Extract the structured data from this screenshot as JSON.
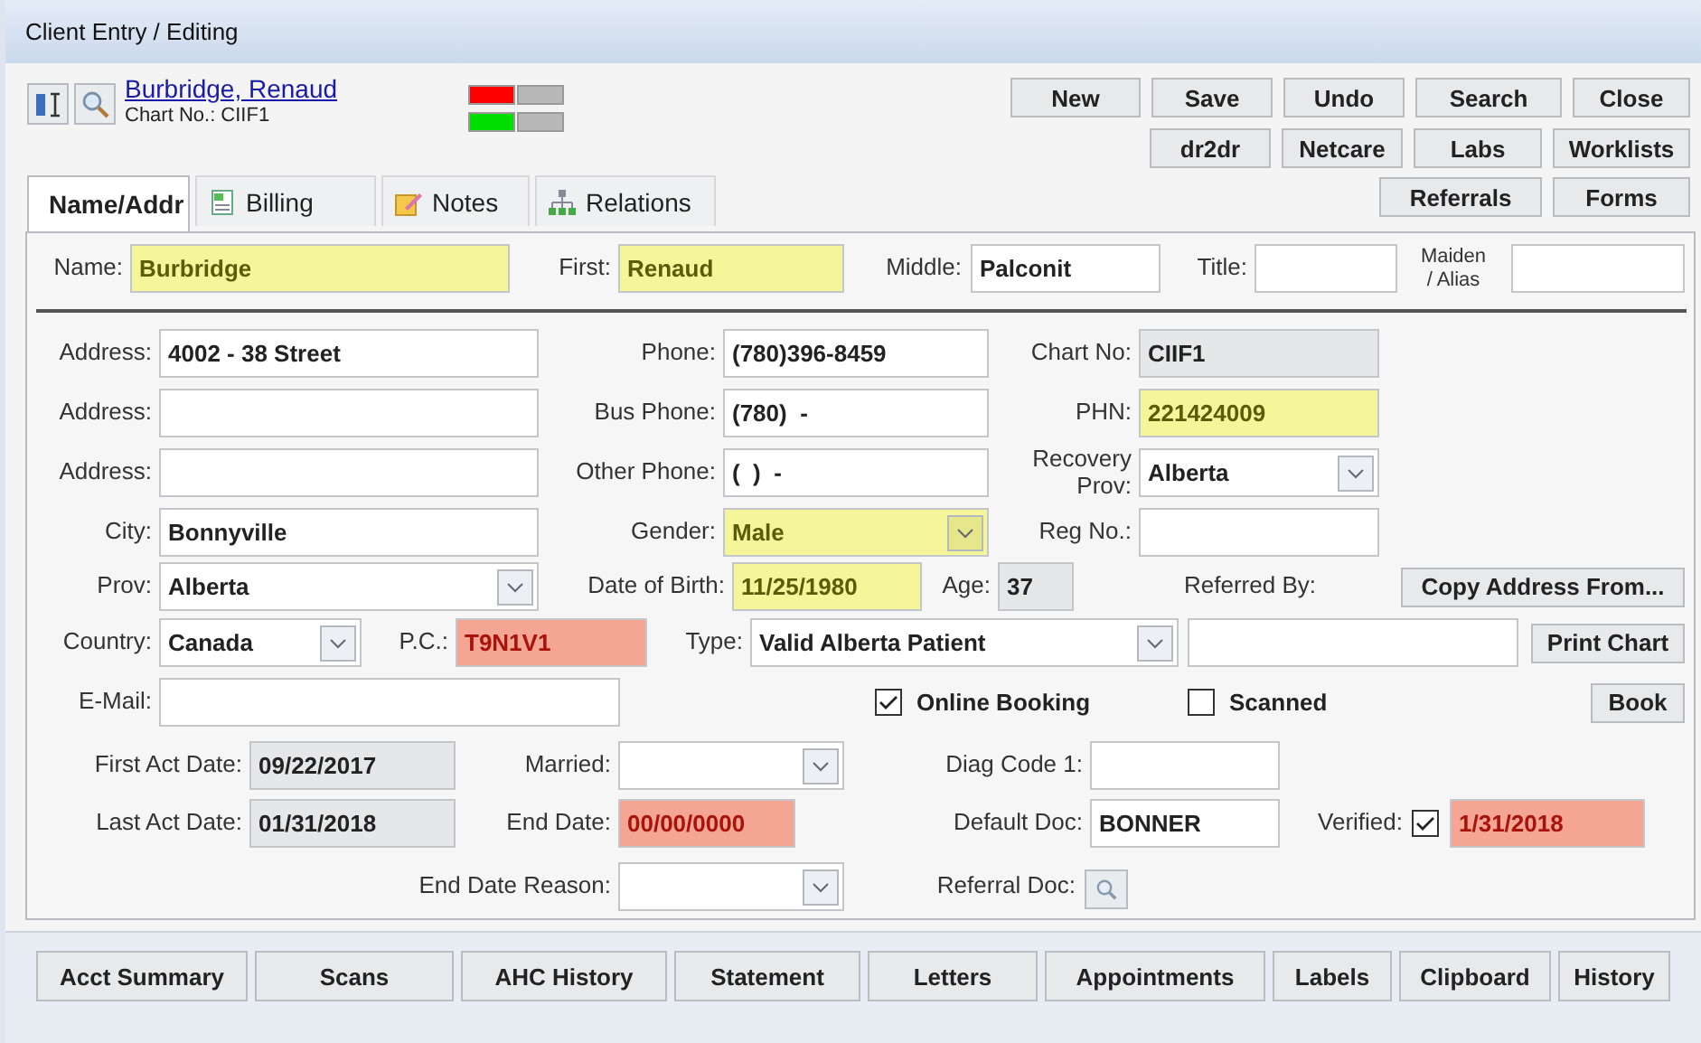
{
  "window": {
    "title": "Client Entry / Editing"
  },
  "header": {
    "patient_link": "Burbridge, Renaud",
    "chart_no": "Chart No.: CIIF1",
    "indicators": [
      {
        "color": "#ff0000"
      },
      {
        "color": "#b8b8b8"
      },
      {
        "color": "#00dd00"
      },
      {
        "color": "#b8b8b8"
      }
    ]
  },
  "toolbar": [
    [
      {
        "label": "New"
      },
      {
        "label": "Save"
      },
      {
        "label": "Undo"
      },
      {
        "label": "Search"
      },
      {
        "label": "Close"
      }
    ],
    [
      {
        "label": "dr2dr"
      },
      {
        "label": "Netcare"
      },
      {
        "label": "Labs"
      },
      {
        "label": "Worklists"
      }
    ],
    [
      {
        "label": "Referrals"
      },
      {
        "label": "Forms"
      }
    ]
  ],
  "tabs": [
    {
      "label": "Name/Addr",
      "selected": true
    },
    {
      "label": "Billing",
      "selected": false
    },
    {
      "label": "Notes",
      "selected": false
    },
    {
      "label": "Relations",
      "selected": false
    }
  ],
  "form_rows": [
    [
      {
        "kind": "label",
        "text": "Name:"
      },
      {
        "kind": "requiredfield",
        "value": "Burbridge"
      },
      {
        "kind": "label",
        "text": "First:"
      },
      {
        "kind": "requiredfield",
        "value": "Renaud"
      },
      {
        "kind": "label",
        "text": "Middle:"
      },
      {
        "kind": "field",
        "value": "Palconit"
      },
      {
        "kind": "label",
        "text": "Title:"
      },
      {
        "kind": "field"
      },
      {
        "kind": "label",
        "text": "Maiden\n/ Alias"
      },
      {
        "kind": "field"
      }
    ],
    [
      {
        "kind": "label",
        "text": "Address:"
      },
      {
        "kind": "field",
        "value": "4002 - 38 Street"
      },
      {
        "kind": "label",
        "text": "Phone:"
      },
      {
        "kind": "field",
        "value": "(780)396-8459"
      },
      {
        "kind": "label",
        "text": "Chart No:"
      },
      {
        "kind": "readonlyfield",
        "value": "CIIF1"
      }
    ],
    [
      {
        "kind": "label",
        "text": "Address:"
      },
      {
        "kind": "field"
      },
      {
        "kind": "label",
        "text": "Bus Phone:"
      },
      {
        "kind": "field",
        "value": "(780)  -"
      },
      {
        "kind": "label",
        "text": "PHN:"
      },
      {
        "kind": "requiredfield",
        "value": "221424009"
      }
    ],
    [
      {
        "kind": "label",
        "text": "Address:"
      },
      {
        "kind": "field"
      },
      {
        "kind": "label",
        "text": "Other Phone:"
      },
      {
        "kind": "field",
        "value": "(  )  -"
      },
      {
        "kind": "label",
        "text": "Recovery\nProv:"
      },
      {
        "kind": "select",
        "value": "Alberta"
      }
    ],
    [
      {
        "kind": "label",
        "text": "City:"
      },
      {
        "kind": "field",
        "value": "Bonnyville"
      },
      {
        "kind": "label",
        "text": "Gender:"
      },
      {
        "kind": "requiredselect",
        "value": "Male"
      },
      {
        "kind": "label",
        "text": "Reg No.:"
      },
      {
        "kind": "field"
      }
    ],
    [
      {
        "kind": "label",
        "text": "Prov:"
      },
      {
        "kind": "select",
        "value": "Alberta"
      },
      {
        "kind": "label",
        "text": "Date of Birth:"
      },
      {
        "kind": "requiredfield",
        "value": "11/25/1980"
      },
      {
        "kind": "label",
        "text": "Age:"
      },
      {
        "kind": "readonlyfield",
        "value": "37"
      },
      {
        "kind": "label",
        "text": "Referred By:"
      },
      {
        "kind": "button",
        "label": "Copy Address From..."
      }
    ],
    [
      {
        "kind": "label",
        "text": "Country:"
      },
      {
        "kind": "select",
        "value": "Canada"
      },
      {
        "kind": "label",
        "text": "P.C.:"
      },
      {
        "kind": "invalidfield",
        "value": "T9N1V1"
      },
      {
        "kind": "label",
        "text": "Type:"
      },
      {
        "kind": "select",
        "value": "Valid Alberta Patient"
      },
      {
        "kind": "field"
      },
      {
        "kind": "button",
        "label": "Print Chart"
      }
    ],
    [
      {
        "kind": "label",
        "text": "E-Mail:"
      },
      {
        "kind": "field"
      },
      {
        "kind": "check",
        "label": "Online Booking",
        "checked": true
      },
      {
        "kind": "check",
        "label": "Scanned",
        "checked": false
      },
      {
        "kind": "button",
        "label": "Book"
      }
    ],
    [
      {
        "kind": "label",
        "text": "First Act Date:"
      },
      {
        "kind": "readonlyfield",
        "value": "09/22/2017"
      },
      {
        "kind": "label",
        "text": "Married:"
      },
      {
        "kind": "select"
      },
      {
        "kind": "label",
        "text": "Diag Code 1:"
      },
      {
        "kind": "field"
      }
    ],
    [
      {
        "kind": "label",
        "text": "Last Act Date:"
      },
      {
        "kind": "readonlyfield",
        "value": "01/31/2018"
      },
      {
        "kind": "label",
        "text": "End Date:"
      },
      {
        "kind": "invalidfield",
        "value": "00/00/0000"
      },
      {
        "kind": "label",
        "text": "Default Doc:"
      },
      {
        "kind": "field",
        "value": "BONNER"
      },
      {
        "kind": "label",
        "text": "Verified:"
      },
      {
        "kind": "check",
        "checked": true
      },
      {
        "kind": "invalidfield",
        "value": "1/31/2018"
      }
    ],
    [
      {
        "kind": "label",
        "text": "End Date Reason:"
      },
      {
        "kind": "select"
      },
      {
        "kind": "label",
        "text": "Referral Doc:"
      },
      {
        "kind": "iconbutton"
      }
    ]
  ],
  "bottom_buttons": [
    {
      "label": "Acct Summary"
    },
    {
      "label": "Scans"
    },
    {
      "label": "AHC History"
    },
    {
      "label": "Statement"
    },
    {
      "label": "Letters"
    },
    {
      "label": "Appointments"
    },
    {
      "label": "Labels"
    },
    {
      "label": "Clipboard"
    },
    {
      "label": "History"
    }
  ]
}
